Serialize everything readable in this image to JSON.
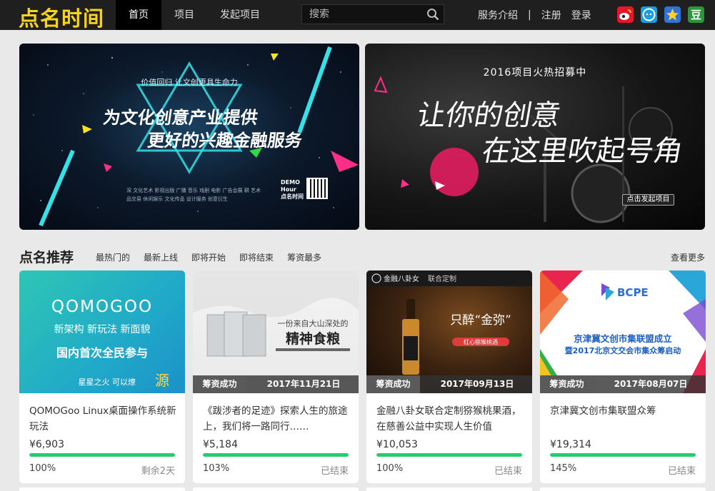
{
  "header": {
    "logo": "点名时间",
    "nav": [
      {
        "label": "首页",
        "active": true
      },
      {
        "label": "项目",
        "active": false
      },
      {
        "label": "发起项目",
        "active": false
      }
    ],
    "search_placeholder": "搜索",
    "service_link": "服务介绍",
    "separator": "|",
    "register": "注册",
    "login": "登录",
    "social": [
      {
        "name": "weibo",
        "label": "微博"
      },
      {
        "name": "weixin",
        "label": "微信"
      },
      {
        "name": "qzone",
        "label": "QQ空间"
      },
      {
        "name": "douban",
        "label": "豆"
      }
    ]
  },
  "banners": {
    "left": {
      "subtitle": "价值回归 让文创更具生命力",
      "line1": "为文化创意产业提供",
      "line2": "更好的兴趣金融服务",
      "footer": "深 文化艺术 影视出版 广播 音乐 戏剧 电影 广告会展 耕 艺术品交易 休闲娱乐 文化传品 设计服务 创意衍生",
      "badge": "DEMO Hour 点名时间"
    },
    "right": {
      "subtitle": "2016项目火热招募中",
      "line1": "让你的创意",
      "line2": "在这里吹起号角",
      "button": "点击发起项目"
    }
  },
  "section": {
    "title": "点名推荐",
    "filters": [
      "最热门的",
      "最新上线",
      "即将开始",
      "即将结束",
      "筹资最多"
    ],
    "more": "查看更多"
  },
  "cards": [
    {
      "title": "QOMOGoo Linux桌面操作系统新玩法",
      "amount": "¥6,903",
      "percent": "100%",
      "progress": 1.0,
      "remaining": "剩余2天",
      "status": "",
      "date": "",
      "image_text": {
        "brand": "QOMOGOO",
        "tags": "新架构 新玩法 新面貌",
        "headline": "国内首次全民参与",
        "slogan": "星星之火 可以燎",
        "slogan_end": "源"
      }
    },
    {
      "title": "《跋涉者的足迹》探索人生的旅途上，我们将一路同行……",
      "amount": "¥5,184",
      "percent": "103%",
      "progress": 1.0,
      "remaining": "已结束",
      "status": "筹资成功",
      "date": "2017年11月21日",
      "image_text": {
        "line1": "一份来自大山深处的",
        "line2": "精神食粮"
      }
    },
    {
      "title": "金融八卦女联合定制猕猴桃果酒，在慈善公益中实现人生价值",
      "amount": "¥10,053",
      "percent": "100%",
      "progress": 1.0,
      "remaining": "已结束",
      "status": "筹资成功",
      "date": "2017年09月13日",
      "image_text": {
        "brand": "金融八卦女",
        "tag": "联合定制",
        "headline": "只醉“金弥”",
        "badge": "红心猕猴桃酒"
      }
    },
    {
      "title": "京津冀文创市集联盟众筹",
      "amount": "¥19,314",
      "percent": "145%",
      "progress": 1.0,
      "remaining": "已结束",
      "status": "筹资成功",
      "date": "2017年08月07日",
      "image_text": {
        "logo": "BCPE",
        "line1": "京津冀文创市集联盟成立",
        "line2": "暨2017北京文交会市集众筹启动"
      }
    }
  ],
  "colors": {
    "logo": "#f7d51d",
    "progress": "#27cc6e",
    "topbar": "#1f1f1f"
  }
}
